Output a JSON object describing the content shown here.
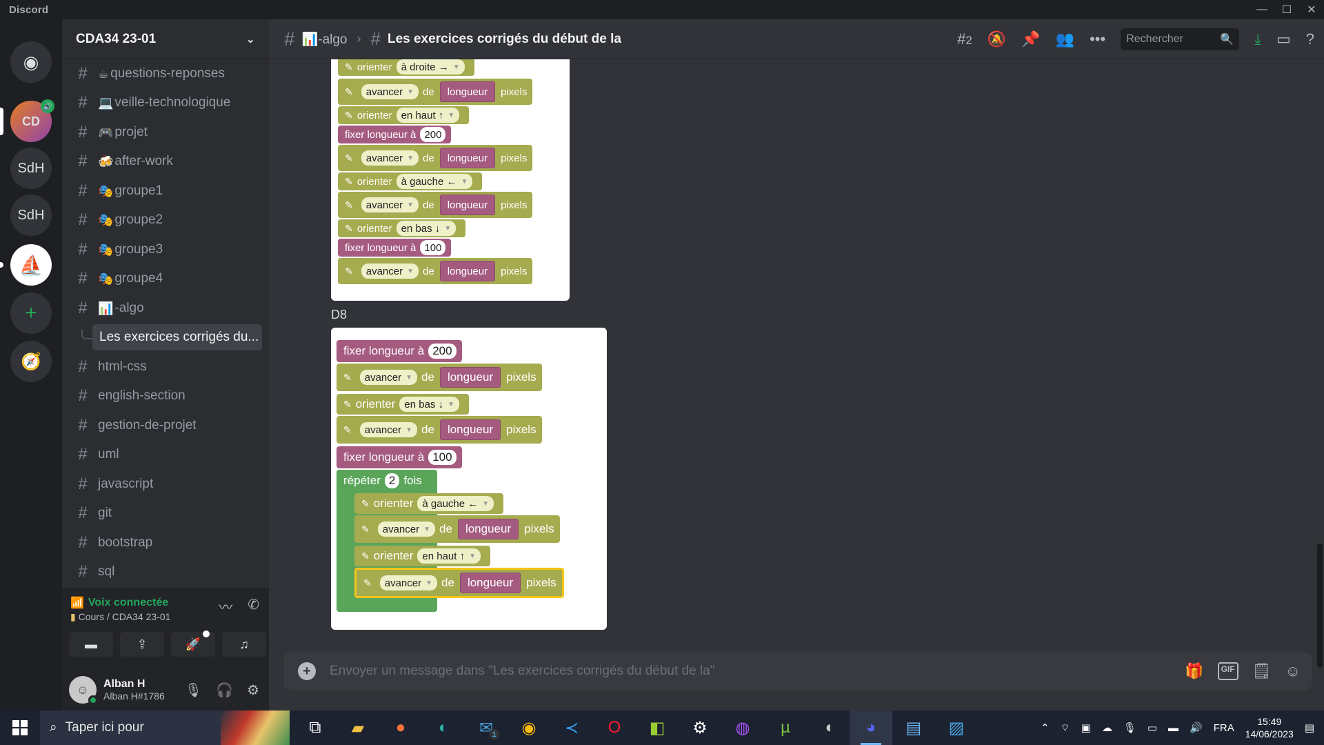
{
  "titlebar": {
    "app_name": "Discord"
  },
  "servers": {
    "items": [
      {
        "label": "",
        "icon": "discord-logo-icon"
      },
      {
        "label": "CD",
        "sub": "23-01"
      },
      {
        "label": "SdH"
      },
      {
        "label": "SdH"
      },
      {
        "label": "",
        "icon": "sailboat-icon"
      },
      {
        "label": "+",
        "icon": "add-server-icon"
      },
      {
        "label": "",
        "icon": "compass-icon"
      }
    ]
  },
  "guild": {
    "name": "CDA34 23-01"
  },
  "channels": [
    {
      "emoji": "☕",
      "name": "questions-reponses"
    },
    {
      "emoji": "💻",
      "name": "veille-technologique"
    },
    {
      "emoji": "🎮",
      "name": "projet"
    },
    {
      "emoji": "🍻",
      "name": "after-work"
    },
    {
      "emoji": "🎭",
      "name": "groupe1"
    },
    {
      "emoji": "🎭",
      "name": "groupe2"
    },
    {
      "emoji": "🎭",
      "name": "groupe3"
    },
    {
      "emoji": "🎭",
      "name": "groupe4"
    },
    {
      "emoji": "📊",
      "name": "-algo"
    },
    {
      "emoji": "",
      "name": "Les exercices corrigés du..."
    },
    {
      "emoji": "",
      "name": "html-css"
    },
    {
      "emoji": "",
      "name": "english-section"
    },
    {
      "emoji": "",
      "name": "gestion-de-projet"
    },
    {
      "emoji": "",
      "name": "uml"
    },
    {
      "emoji": "",
      "name": "javascript"
    },
    {
      "emoji": "",
      "name": "git"
    },
    {
      "emoji": "",
      "name": "bootstrap"
    },
    {
      "emoji": "",
      "name": "sql"
    }
  ],
  "voice": {
    "status": "Voix connectée",
    "location": "Cours / CDA34 23-01"
  },
  "user": {
    "name": "Alban H",
    "tag": "Alban H#1786"
  },
  "header": {
    "parent_channel": "-algo",
    "parent_emoji": "📊",
    "thread_title": "Les exercices corrigés du début de la",
    "threads_count": "2",
    "search_placeholder": "Rechercher"
  },
  "message": {
    "label_d8": "D8"
  },
  "blocks": {
    "orient": "orienter",
    "advance": "avancer",
    "of": "de",
    "var": "longueur",
    "pixels": "pixels",
    "set_length": "fixer longueur à",
    "repeat": "répéter",
    "times": "fois",
    "dir_right": "à droite →",
    "dir_up": "en haut ↑",
    "dir_left": "à gauche ←",
    "dir_down": "en bas ↓",
    "n200": "200",
    "n100": "100",
    "n2": "2"
  },
  "composer": {
    "placeholder": "Envoyer un message dans \"Les exercices corrigés du début de la\""
  },
  "taskbar": {
    "search_placeholder": "Taper ici pour",
    "lang": "FRA",
    "time": "15:49",
    "date": "14/06/2023",
    "mail_badge": "1"
  }
}
